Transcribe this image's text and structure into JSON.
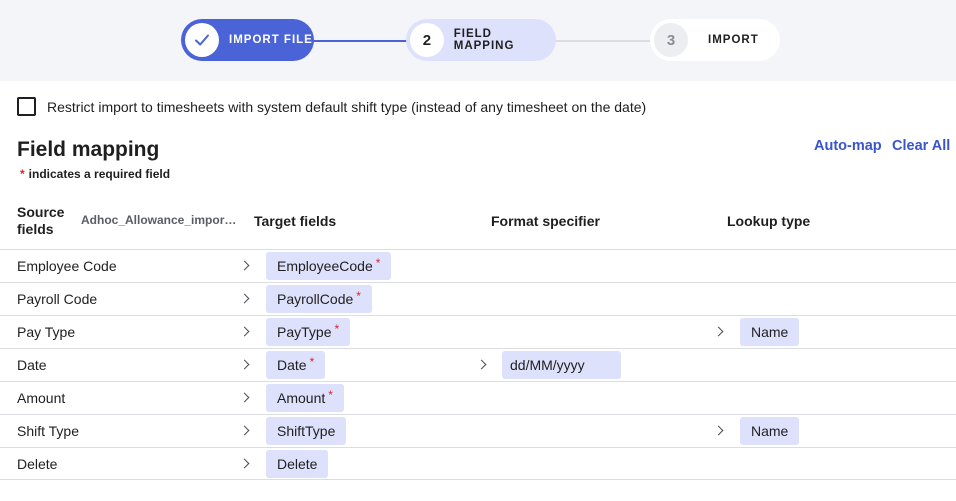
{
  "stepper": {
    "steps": [
      {
        "label": "IMPORT FILE",
        "state": "complete"
      },
      {
        "number": "2",
        "label": "FIELD MAPPING",
        "state": "active"
      },
      {
        "number": "3",
        "label": "IMPORT",
        "state": "pending"
      }
    ]
  },
  "restrict": {
    "label": "Restrict import to timesheets with system default shift type (instead of any timesheet on the date)",
    "checked": false
  },
  "mapping": {
    "title": "Field mapping",
    "required_star": "*",
    "required_note": "indicates a required field",
    "automap_label": "Auto-map",
    "clearall_label": "Clear All"
  },
  "columns": {
    "source": "Source fields",
    "source_file": "Adhoc_Allowance_import...",
    "target": "Target fields",
    "format": "Format specifier",
    "lookup": "Lookup type"
  },
  "rows": [
    {
      "source": "Employee Code",
      "target": "EmployeeCode",
      "required": true
    },
    {
      "source": "Payroll Code",
      "target": "PayrollCode",
      "required": true
    },
    {
      "source": "Pay Type",
      "target": "PayType",
      "required": true,
      "lookup": "Name"
    },
    {
      "source": "Date",
      "target": "Date",
      "required": true,
      "format": "dd/MM/yyyy"
    },
    {
      "source": "Amount",
      "target": "Amount",
      "required": true
    },
    {
      "source": "Shift Type",
      "target": "ShiftType",
      "required": false,
      "lookup": "Name"
    },
    {
      "source": "Delete",
      "target": "Delete",
      "required": false
    }
  ],
  "colors": {
    "accent": "#4a63d6",
    "chip": "#dde1fb",
    "link": "#3a55c9",
    "required": "#d6282a"
  }
}
